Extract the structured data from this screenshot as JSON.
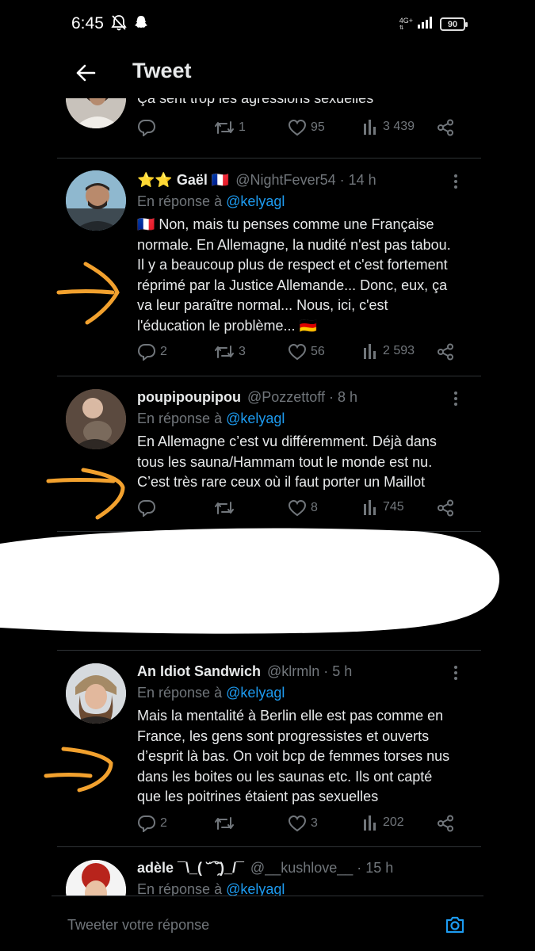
{
  "status_bar": {
    "time": "6:45",
    "network": "4G+",
    "battery": "90"
  },
  "header": {
    "title": "Tweet"
  },
  "tweets": [
    {
      "text_lines": [
        "Ça sent trop les agressions sexuelles"
      ],
      "replies": "",
      "retweets": "1",
      "likes": "95",
      "views": "3 439"
    },
    {
      "name": "⭐⭐ Gaël 🇫🇷",
      "handle": "@NightFever54 · 14 h",
      "reply_prefix": "En réponse à",
      "reply_mention": "@kelyagl",
      "text_lines": [
        "🇫🇷 Non, mais tu penses comme une Française",
        "normale. En Allemagne, la nudité n'est pas tabou.",
        "Il y a beaucoup plus de respect et c'est fortement",
        "réprimé par la Justice Allemande... Donc, eux, ça",
        "va leur paraître normal... Nous, ici, c'est",
        "l'éducation le problème... 🇩🇪"
      ],
      "replies": "2",
      "retweets": "3",
      "likes": "56",
      "views": "2 593"
    },
    {
      "name": "poupipoupipou",
      "handle": "@Pozzettoff · 8 h",
      "reply_prefix": "En réponse à",
      "reply_mention": "@kelyagl",
      "text_lines": [
        "En Allemagne c’est vu différemment. Déjà dans",
        "tous les sauna/Hammam tout le monde est nu.",
        "C’est très rare ceux où il faut porter un Maillot"
      ],
      "replies": "",
      "retweets": "",
      "likes": "8",
      "views": "745"
    },
    {
      "name": "An Idiot Sandwich",
      "handle": "@klrmln · 5 h",
      "reply_prefix": "En réponse à",
      "reply_mention": "@kelyagl",
      "text_lines": [
        "Mais la mentalité à Berlin elle est pas comme en",
        "France, les gens sont progressistes et ouverts",
        "d’esprit là bas. On voit bcp de femmes torses nus",
        "dans les boites ou les saunas etc. Ils ont capté",
        "que les poitrines étaient pas sexuelles"
      ],
      "replies": "2",
      "retweets": "",
      "likes": "3",
      "views": "202"
    },
    {
      "name": "adèle ¯\\_( ˘͡ ˘̯)_/¯",
      "handle": "@__kushlove__ · 15 h",
      "reply_prefix": "En réponse à",
      "reply_mention": "@kelyagl"
    }
  ],
  "reply_bar": {
    "placeholder": "Tweeter votre réponse"
  },
  "colors": {
    "accent": "#1d9bf0",
    "annotation_arrow": "#f2a12e",
    "muted": "#71767b",
    "background": "#000000"
  }
}
